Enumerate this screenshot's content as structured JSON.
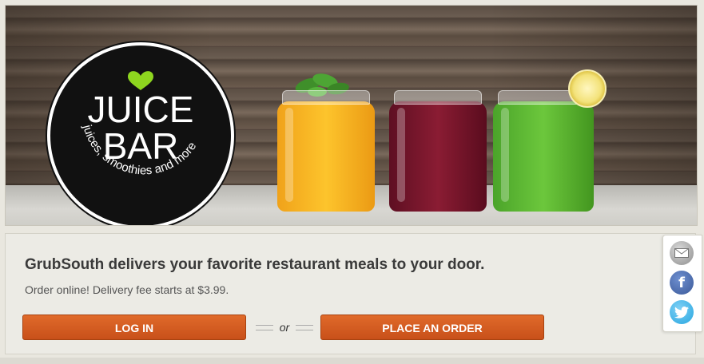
{
  "hero": {
    "logo": {
      "title": "JUICE\nBAR",
      "title_line1": "JUICE",
      "title_line2": "BAR",
      "tagline": "juices, smoothies and more",
      "heart_color": "#8ed61f"
    },
    "image_alt": "three juice jars"
  },
  "panel": {
    "headline": "GrubSouth delivers your favorite restaurant meals to your door.",
    "subline": "Order online! Delivery fee starts at $3.99.",
    "login_label": "LOG IN",
    "or_label": "or",
    "order_label": "PLACE AN ORDER",
    "accent_color": "#c8501a"
  },
  "share": {
    "icons": [
      "email-icon",
      "facebook-icon",
      "twitter-icon"
    ],
    "facebook_glyph": "f"
  }
}
